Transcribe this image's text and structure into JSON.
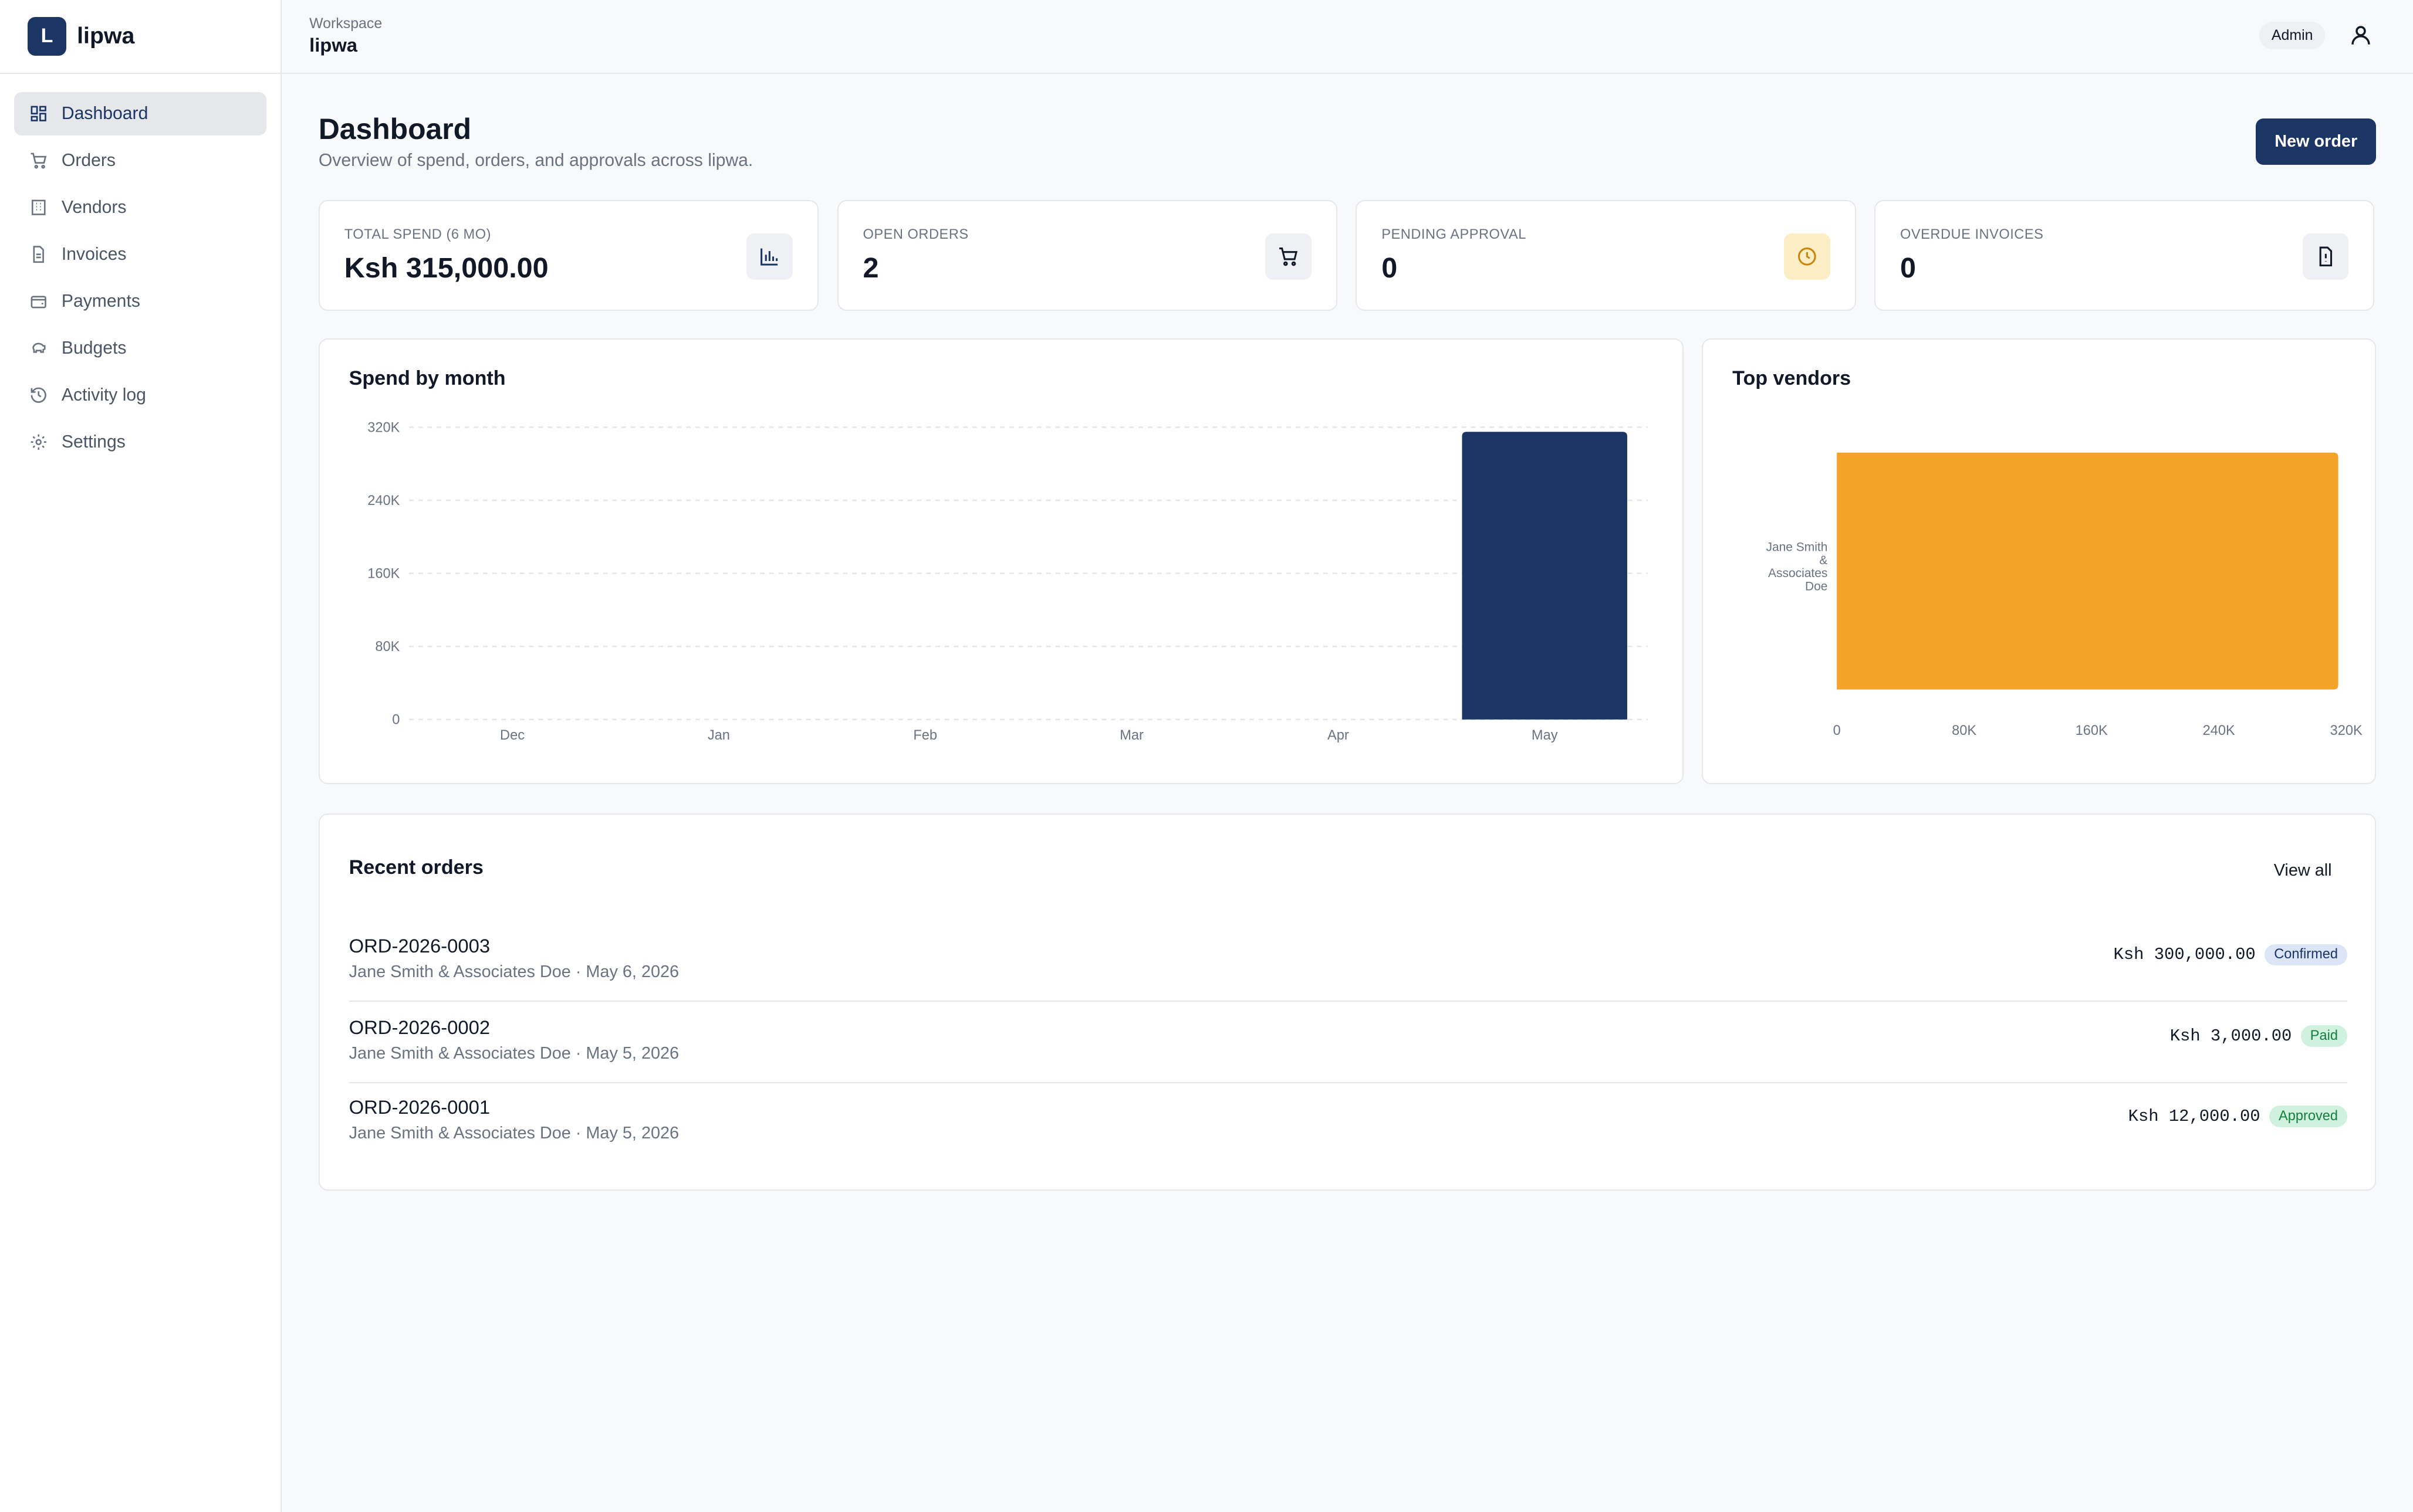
{
  "brand": {
    "logo_letter": "L",
    "name": "lipwa"
  },
  "sidebar": {
    "items": [
      {
        "label": "Dashboard",
        "icon": "grid-icon",
        "active": true
      },
      {
        "label": "Orders",
        "icon": "cart-icon"
      },
      {
        "label": "Vendors",
        "icon": "building-icon"
      },
      {
        "label": "Invoices",
        "icon": "file-icon"
      },
      {
        "label": "Payments",
        "icon": "wallet-icon"
      },
      {
        "label": "Budgets",
        "icon": "piggy-bank-icon"
      },
      {
        "label": "Activity log",
        "icon": "history-icon"
      },
      {
        "label": "Settings",
        "icon": "gear-icon"
      }
    ]
  },
  "topbar": {
    "workspace_label": "Workspace",
    "workspace_name": "lipwa",
    "role": "Admin"
  },
  "page": {
    "title": "Dashboard",
    "subtitle": "Overview of spend, orders, and approvals across lipwa.",
    "new_order_label": "New order"
  },
  "stats": [
    {
      "label": "TOTAL SPEND (6 MO)",
      "value": "Ksh 315,000.00",
      "icon": "bar-chart-icon"
    },
    {
      "label": "OPEN ORDERS",
      "value": "2",
      "icon": "cart-icon"
    },
    {
      "label": "PENDING APPROVAL",
      "value": "0",
      "icon": "clock-icon"
    },
    {
      "label": "OVERDUE INVOICES",
      "value": "0",
      "icon": "file-alert-icon"
    }
  ],
  "colors": {
    "primary": "#1b3565",
    "vendor_bar": "#f4a328",
    "warn_bg": "#fdedc4",
    "warn_icon": "#c8860e"
  },
  "chart_data": [
    {
      "type": "bar",
      "title": "Spend by month",
      "categories": [
        "Dec",
        "Jan",
        "Feb",
        "Mar",
        "Apr",
        "May"
      ],
      "values": [
        0,
        0,
        0,
        0,
        0,
        315000
      ],
      "ylim": [
        0,
        320000
      ],
      "yticks": [
        "0",
        "80K",
        "160K",
        "240K",
        "320K"
      ],
      "grid": true
    },
    {
      "type": "bar",
      "orientation": "horizontal",
      "title": "Top vendors",
      "categories": [
        "Jane Smith & Associates Doe"
      ],
      "category_label_lines": [
        "Jane Smith",
        "&",
        "Associates",
        "Doe"
      ],
      "values": [
        315000
      ],
      "xlim": [
        0,
        320000
      ],
      "xticks": [
        "0",
        "80K",
        "160K",
        "240K",
        "320K"
      ]
    }
  ],
  "recent_orders": {
    "title": "Recent orders",
    "view_all_label": "View all",
    "rows": [
      {
        "id": "ORD-2026-0003",
        "meta": "Jane Smith & Associates Doe · May 6, 2026",
        "amount": "Ksh 300,000.00",
        "status": "Confirmed"
      },
      {
        "id": "ORD-2026-0002",
        "meta": "Jane Smith & Associates Doe · May 5, 2026",
        "amount": "Ksh 3,000.00",
        "status": "Paid"
      },
      {
        "id": "ORD-2026-0001",
        "meta": "Jane Smith & Associates Doe · May 5, 2026",
        "amount": "Ksh 12,000.00",
        "status": "Approved"
      }
    ]
  }
}
